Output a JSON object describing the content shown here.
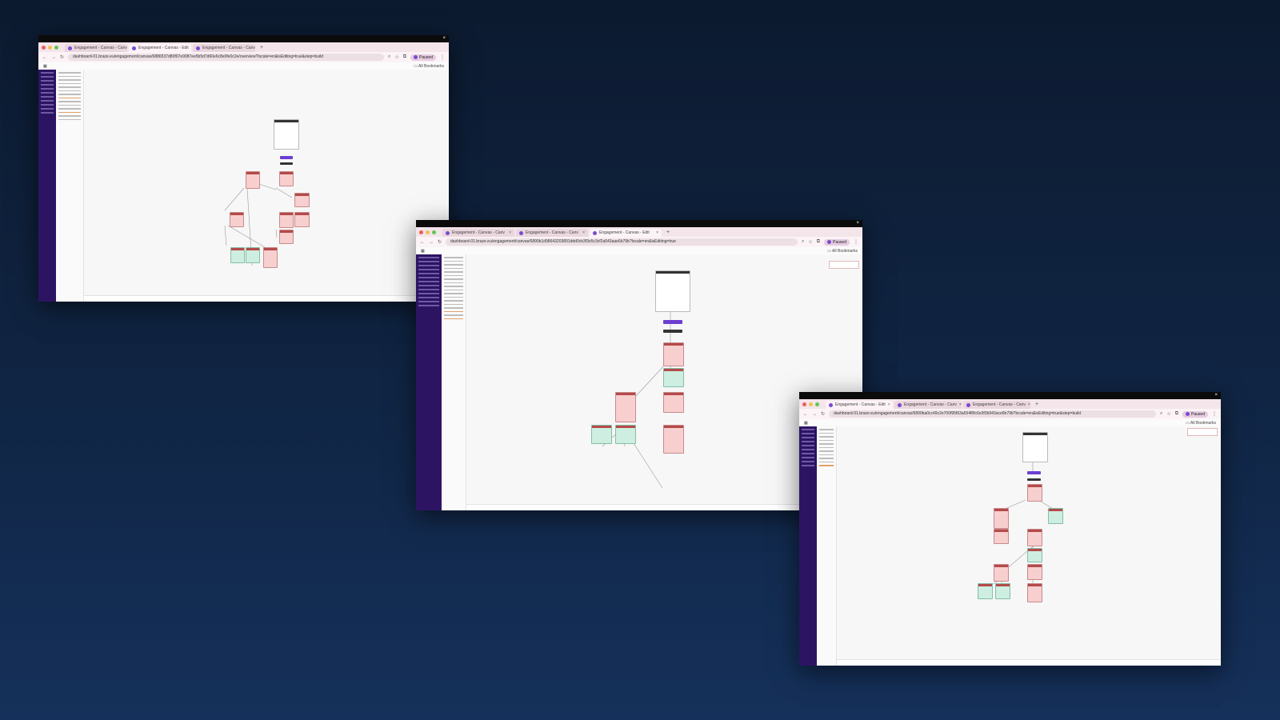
{
  "windows": [
    {
      "tabs": [
        "Engagement - Canvas - Canv",
        "Engagement - Canvas - Edit",
        "Engagement - Canvas - Canv"
      ],
      "active_tab": 1,
      "url": "dashboard-01.braze.eu/engagement/canvas/6886537d80f07e9087ee5b5d7d60e6c8e0fe0c2e/overview?locale=en&isEditing=true&step=build",
      "profile": "Paused",
      "bookmarks": "All Bookmarks"
    },
    {
      "tabs": [
        "Engagement - Canvas - Canv",
        "Engagement - Canvas - Canv",
        "Engagement - Canvas - Edit"
      ],
      "active_tab": 2,
      "url": "dashboard-01.braze.eu/engagement/canvas/6890b1d98643203891ddd0cb3f3e5c3cf2a543aae6b79b?locale=en&isEditing=true",
      "profile": "Paused",
      "bookmarks": "All Bookmarks"
    },
    {
      "tabs": [
        "Engagement - Canvas - Edit",
        "Engagement - Canvas - Canv",
        "Engagement - Canvas - Canv"
      ],
      "active_tab": 0,
      "url": "dashboard-01.braze.eu/engagement/canvas/6890ba0cc49c2e700f95f63a554f6fc6e3f3b943ace6b79b?locale=en&isEditing=true&step=build",
      "profile": "Paused",
      "bookmarks": "All Bookmarks"
    }
  ],
  "colors": {
    "sidebar": "#2d1463",
    "step_header": "#b54a4a",
    "step_body": "#f7cfcf",
    "step_success": "#cdeee0",
    "primary_button": "#6b3fd1"
  },
  "icons": [
    "close-icon",
    "back-icon",
    "forward-icon",
    "reload-icon",
    "search-icon",
    "star-icon",
    "extensions-icon",
    "menu-icon",
    "apps-icon",
    "folder-icon"
  ]
}
